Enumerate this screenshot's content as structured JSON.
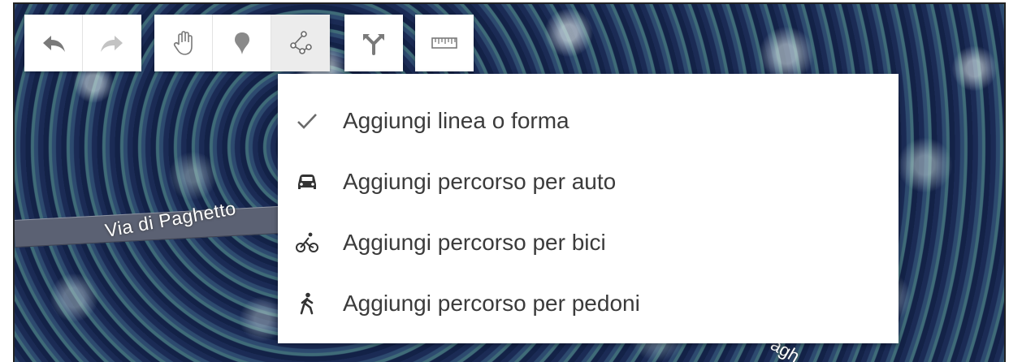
{
  "map": {
    "road_label_1": "Via di Paghetto",
    "road_label_2": "agh"
  },
  "toolbar": {
    "undo": {
      "icon": "undo-arrow-icon"
    },
    "redo": {
      "icon": "redo-arrow-icon"
    },
    "hand": {
      "icon": "hand-icon"
    },
    "marker": {
      "icon": "map-pin-icon"
    },
    "line": {
      "icon": "draw-line-icon",
      "active": true
    },
    "directions": {
      "icon": "directions-icon"
    },
    "measure": {
      "icon": "ruler-icon"
    }
  },
  "menu": {
    "items": [
      {
        "label": "Aggiungi linea o forma",
        "icon": "checkmark-icon",
        "selected": true
      },
      {
        "label": "Aggiungi percorso per auto",
        "icon": "car-icon"
      },
      {
        "label": "Aggiungi percorso per bici",
        "icon": "bike-icon"
      },
      {
        "label": "Aggiungi percorso per pedoni",
        "icon": "walk-icon"
      }
    ]
  },
  "colors": {
    "toolbar_bg": "#ffffff",
    "icon_gray": "#777777",
    "menu_text": "#3b3b3b",
    "active_tool_bg": "#ececec"
  }
}
